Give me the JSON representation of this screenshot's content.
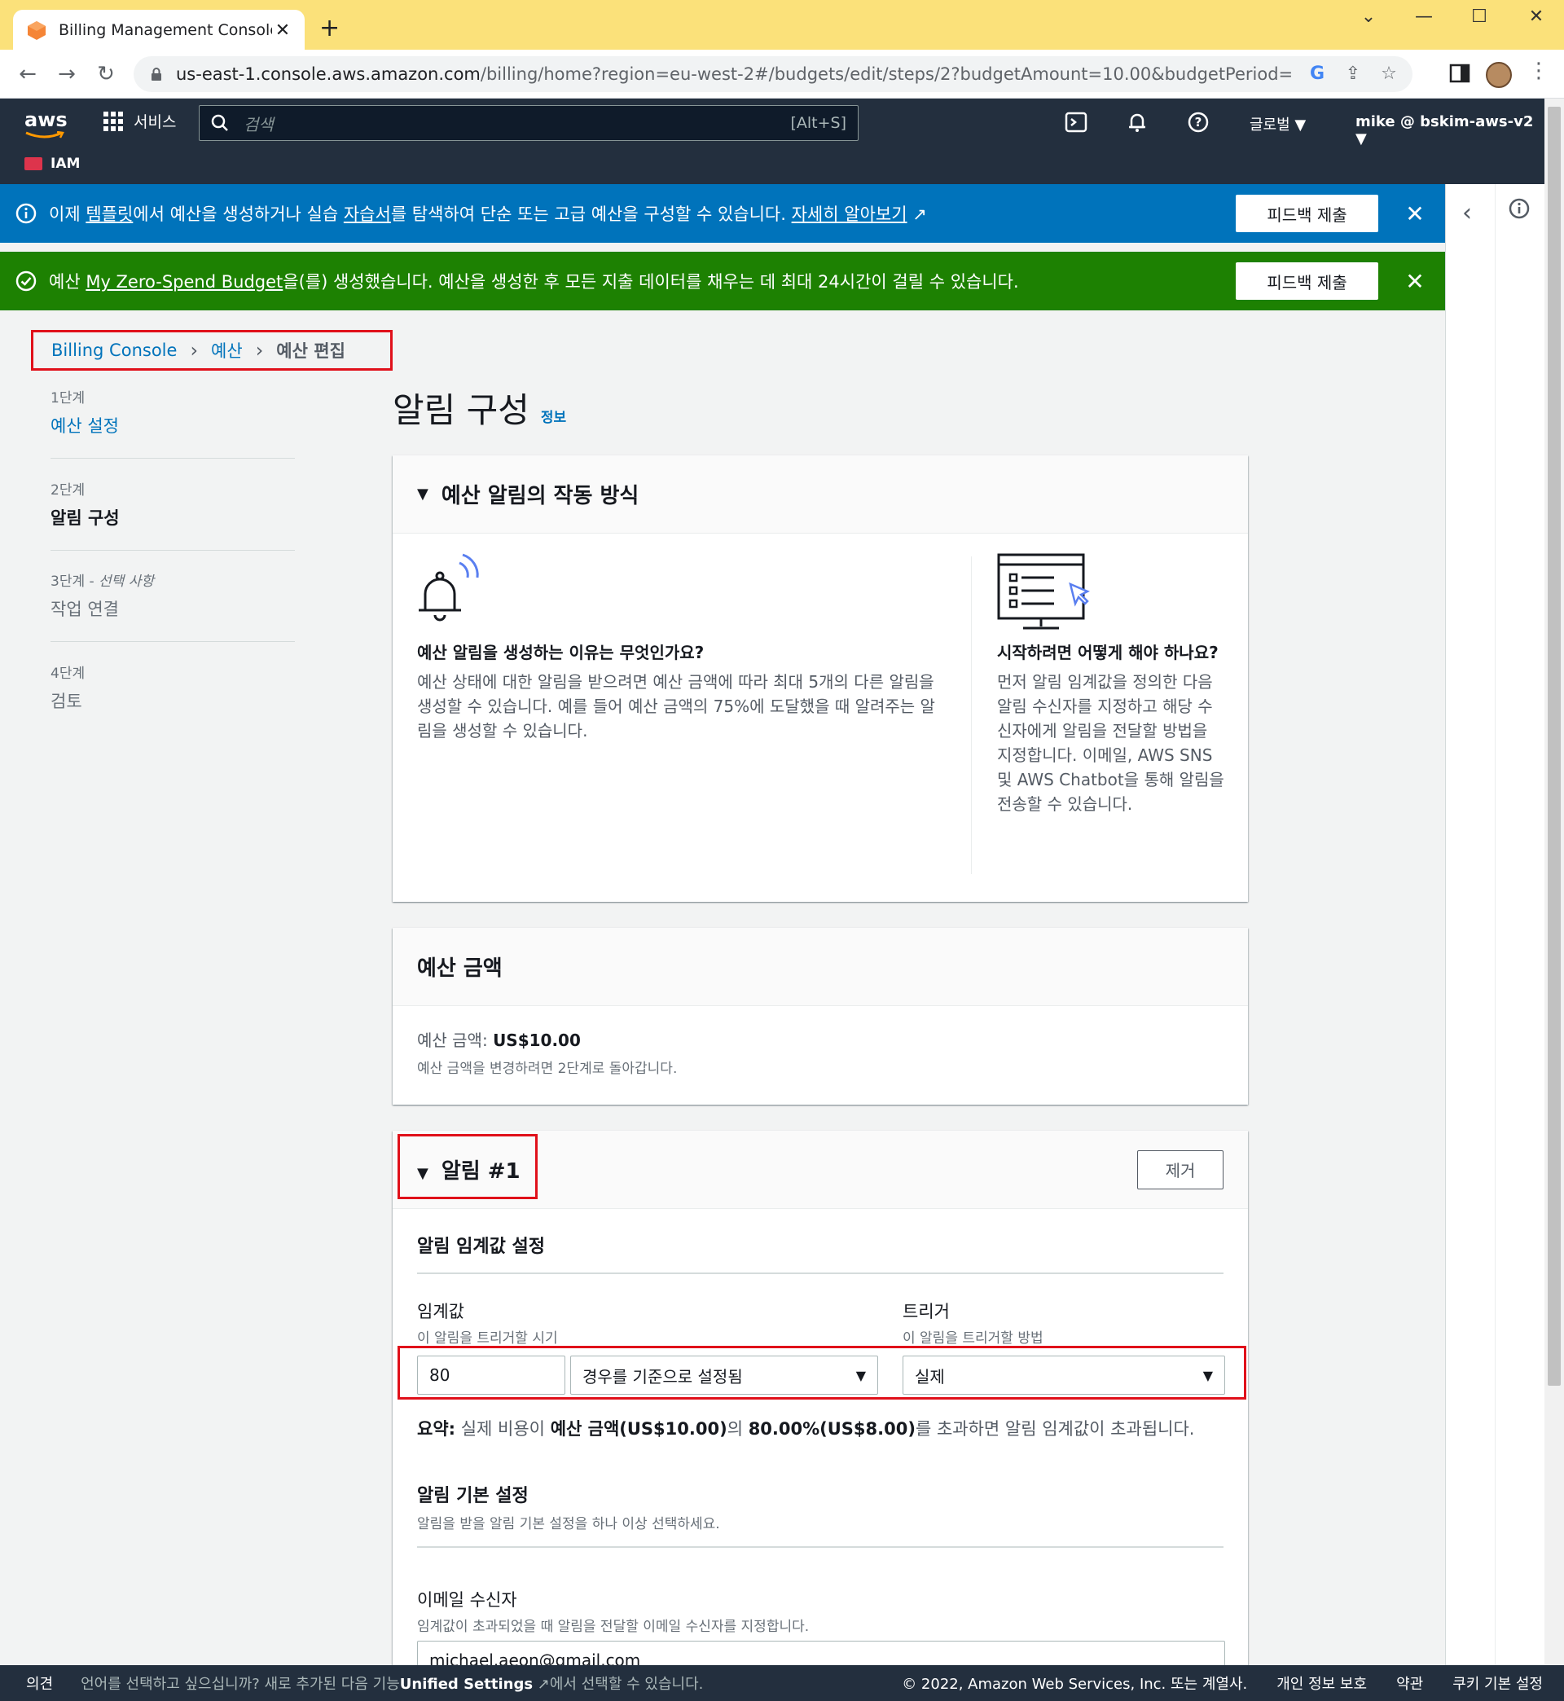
{
  "browser": {
    "tab_title": "Billing Management Console",
    "url_host": "us-east-1.console.aws.amazon.com",
    "url_path": "/billing/home?region=eu-west-2#/budgets/edit/steps/2?budgetAmount=10.00&budgetPeriod=Monthly&bu..."
  },
  "nav": {
    "logo": "aws",
    "services": "서비스",
    "search_placeholder": "검색",
    "search_shortcut": "[Alt+S]",
    "region": "글로벌 ▼",
    "account": "mike @ bskim-aws-v2 ▼",
    "favorite": "IAM"
  },
  "flash_info": {
    "prefix": "이제 ",
    "link1": "템플릿",
    "middle1": "에서 예산을 생성하거나 실습 ",
    "link2": "자습서",
    "middle2": "를 탐색하여 단순 또는 고급 예산을 구성할 수 있습니다. ",
    "link3": "자세히 알아보기",
    "button": "피드백 제출"
  },
  "flash_success": {
    "prefix": "예산 ",
    "link": "My Zero-Spend Budget",
    "suffix": "을(를) 생성했습니다. 예산을 생성한 후 모든 지출 데이터를 채우는 데 최대 24시간이 걸릴 수 있습니다.",
    "button": "피드백 제출"
  },
  "breadcrumb": {
    "root": "Billing Console",
    "mid": "예산",
    "current": "예산 편집"
  },
  "steps": [
    {
      "num": "1단계",
      "label": "예산 설정"
    },
    {
      "num": "2단계",
      "label": "알림 구성"
    },
    {
      "num": "3단계 - ",
      "opt": "선택 사항",
      "label": "작업 연결"
    },
    {
      "num": "4단계",
      "label": "검토"
    }
  ],
  "page": {
    "title": "알림 구성",
    "info": "정보"
  },
  "howit": {
    "title": "예산 알림의 작동 방식",
    "q1": "예산 알림을 생성하는 이유는 무엇인가요?",
    "a1": "예산 상태에 대한 알림을 받으려면 예산 금액에 따라 최대 5개의 다른 알림을 생성할 수 있습니다. 예를 들어 예산 금액의 75%에 도달했을 때 알려주는 알림을 생성할 수 있습니다.",
    "q2": "시작하려면 어떻게 해야 하나요?",
    "a2": "먼저 알림 임계값을 정의한 다음 알림 수신자를 지정하고 해당 수신자에게 알림을 전달할 방법을 지정합니다. 이메일, AWS SNS 및 AWS Chatbot을 통해 알림을 전송할 수 있습니다."
  },
  "budget_amount": {
    "title": "예산 금액",
    "label": "예산 금액: ",
    "value": "US$10.00",
    "hint": "예산 금액을 변경하려면 2단계로 돌아갑니다."
  },
  "alert": {
    "title": "알림 #1",
    "remove": "제거",
    "threshold_section": "알림 임계값 설정",
    "threshold_label": "임계값",
    "threshold_desc": "이 알림을 트리거할 시기",
    "threshold_value": "80",
    "threshold_type": "경우를 기준으로 설정됨",
    "trigger_label": "트리거",
    "trigger_desc": "이 알림을 트리거할 방법",
    "trigger_value": "실제",
    "summary_label": "요약:",
    "summary_1": " 실제 비용이 ",
    "summary_b1": "예산 금액(US$10.00)",
    "summary_2": "의 ",
    "summary_b2": "80.00%(US$8.00)",
    "summary_3": "를 초과하면 알림 임계값이 초과됩니다.",
    "pref_section": "알림 기본 설정",
    "pref_desc": "알림을 받을 알림 기본 설정을 하나 이상 선택하세요.",
    "email_label": "이메일 수신자",
    "email_desc": "임계값이 초과되었을 때 알림을 전달할 이메일 수신자를 지정합니다.",
    "email_value": "michael.aeon@gmail.com"
  },
  "footer": {
    "feedback": "의견",
    "lang_prefix": "언어를 선택하고 싶으십니까? 새로 추가된 다음 기능",
    "lang_link": "Unified Settings",
    "lang_suffix": "에서 선택할 수 있습니다.",
    "copyright": "© 2022, Amazon Web Services, Inc. 또는 계열사.",
    "privacy": "개인 정보 보호",
    "terms": "약관",
    "cookies": "쿠키 기본 설정"
  }
}
